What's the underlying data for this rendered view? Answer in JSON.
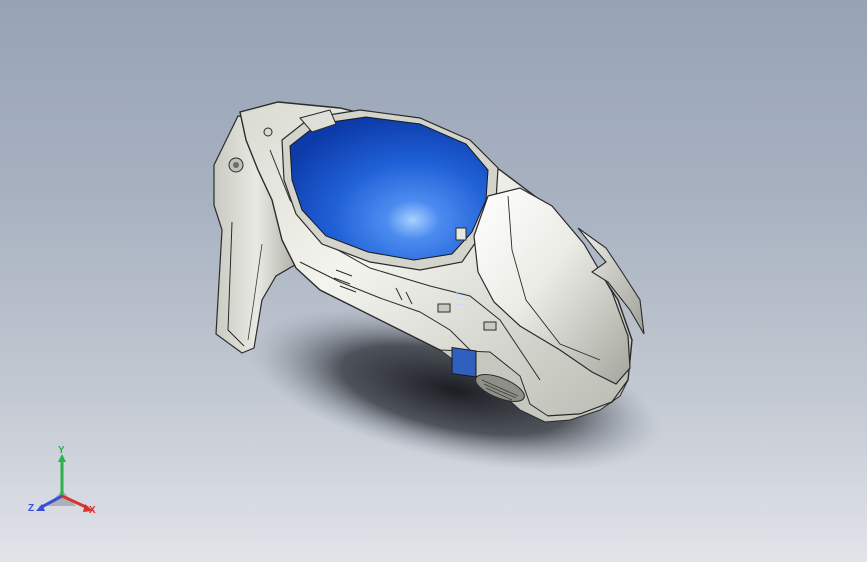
{
  "viewport": {
    "background_top": "#97a3b5",
    "background_bottom": "#e1e4e9"
  },
  "model": {
    "body_color": "#e3e4dc",
    "edge_color": "#2b2b2b",
    "canopy_color": "#1f5fd6",
    "canopy_highlight": "#8fc0ff"
  },
  "triad": {
    "y_label": "Y",
    "z_label": "Z",
    "x_label": "X",
    "colors": {
      "y": "#2bb04a",
      "z": "#3a4fd8",
      "x": "#d8332f"
    }
  }
}
